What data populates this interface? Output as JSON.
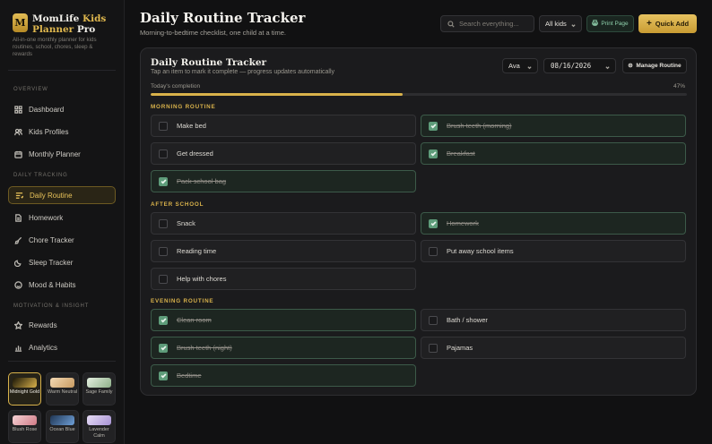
{
  "sidebar": {
    "brand_initial": "M",
    "brand_name_1": "MomLife",
    "brand_name_gold": "Kids",
    "brand_name_2": "Planner",
    "brand_name_3": "Pro",
    "tagline": "All-in-one monthly planner for kids routines, school, chores, sleep & rewards",
    "sections": {
      "overview": "OVERVIEW",
      "daily": "DAILY TRACKING",
      "motivation": "MOTIVATION & INSIGHT"
    },
    "items": [
      {
        "label": "Dashboard",
        "icon": "grid-icon"
      },
      {
        "label": "Kids Profiles",
        "icon": "users-icon"
      },
      {
        "label": "Monthly Planner",
        "icon": "calendar-icon"
      },
      {
        "label": "Daily Routine",
        "icon": "list-icon",
        "active": true
      },
      {
        "label": "Homework",
        "icon": "document-icon"
      },
      {
        "label": "Chore Tracker",
        "icon": "broom-icon"
      },
      {
        "label": "Sleep Tracker",
        "icon": "moon-icon"
      },
      {
        "label": "Mood & Habits",
        "icon": "smile-icon"
      },
      {
        "label": "Rewards",
        "icon": "star-icon"
      },
      {
        "label": "Analytics",
        "icon": "bar-chart-icon"
      }
    ],
    "themes": [
      {
        "name": "Midnight Gold",
        "colors": [
          "#1a1607",
          "#d9b24b"
        ],
        "selected": true
      },
      {
        "name": "Warm Neutral",
        "colors": [
          "#f3d9b4",
          "#c89b62"
        ]
      },
      {
        "name": "Sage Family",
        "colors": [
          "#e4efe0",
          "#8fb08a"
        ]
      },
      {
        "name": "Blush Rose",
        "colors": [
          "#f6d3d6",
          "#d07b86"
        ]
      },
      {
        "name": "Ocean Blue",
        "colors": [
          "#1f3553",
          "#6fa0d8"
        ]
      },
      {
        "name": "Lavender Calm",
        "colors": [
          "#e7ddf6",
          "#a893d4"
        ]
      }
    ]
  },
  "header": {
    "title": "Daily Routine Tracker",
    "subtitle": "Morning-to-bedtime checklist, one child at a time.",
    "search_placeholder": "Search everything...",
    "kids_filter": "All kids",
    "print_label": "Print Page",
    "quick_add_label": "Quick Add"
  },
  "card": {
    "title": "Daily Routine Tracker",
    "subtitle": "Tap an item to mark it complete — progress updates automatically",
    "child": "Ava",
    "date": "08/16/2026",
    "manage_label": "Manage Routine",
    "progress_label": "Today's completion",
    "progress_text": "47%",
    "progress_value": 0.47,
    "groups": [
      {
        "name": "MORNING ROUTINE",
        "tasks": [
          {
            "label": "Make bed",
            "done": false
          },
          {
            "label": "Brush teeth (morning)",
            "done": true
          },
          {
            "label": "Get dressed",
            "done": false
          },
          {
            "label": "Breakfast",
            "done": true
          },
          {
            "label": "Pack school bag",
            "done": true
          }
        ]
      },
      {
        "name": "AFTER SCHOOL",
        "tasks": [
          {
            "label": "Snack",
            "done": false
          },
          {
            "label": "Homework",
            "done": true
          },
          {
            "label": "Reading time",
            "done": false
          },
          {
            "label": "Put away school items",
            "done": false
          },
          {
            "label": "Help with chores",
            "done": false
          }
        ]
      },
      {
        "name": "EVENING ROUTINE",
        "tasks": [
          {
            "label": "Clean room",
            "done": true
          },
          {
            "label": "Bath / shower",
            "done": false
          },
          {
            "label": "Brush teeth (night)",
            "done": true
          },
          {
            "label": "Pajamas",
            "done": false
          },
          {
            "label": "Bedtime",
            "done": true
          }
        ]
      }
    ]
  },
  "colors": {
    "accent": "#d9b24b",
    "done_green": "#5e9c7a",
    "background": "#111112"
  }
}
